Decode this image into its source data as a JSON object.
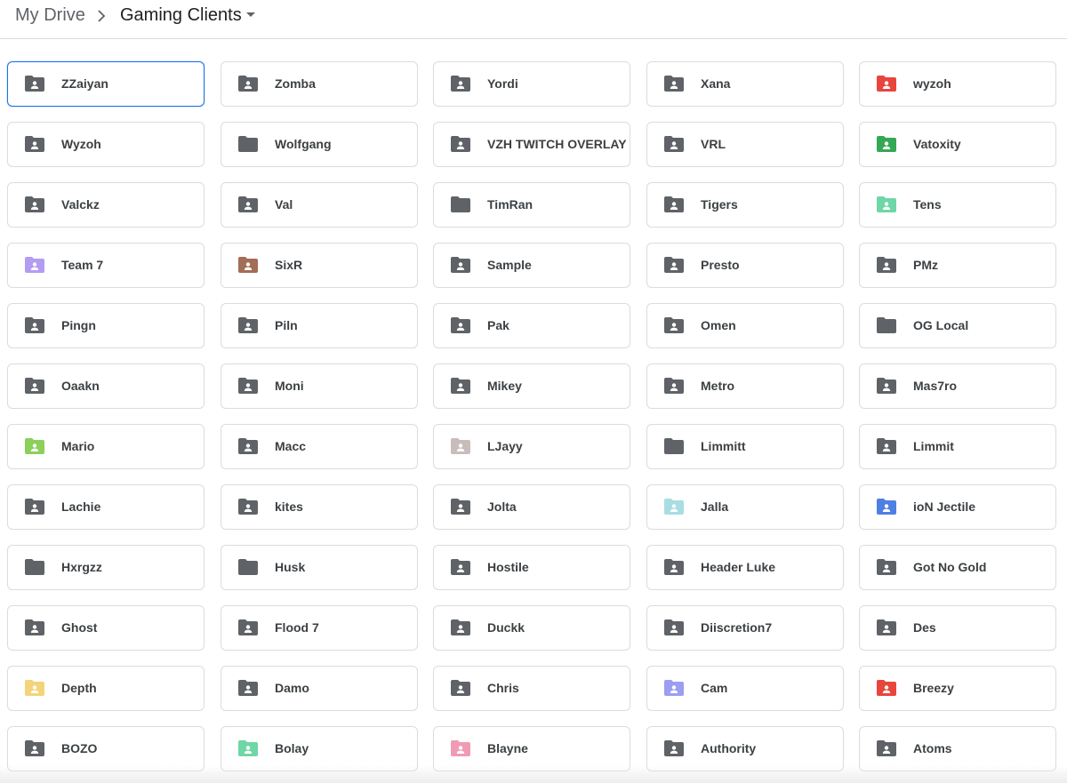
{
  "breadcrumb": {
    "root": "My Drive",
    "current": "Gaming Clients"
  },
  "colors": {
    "default_folder": "#5f6368",
    "selected_border": "#1a73e8"
  },
  "folders": [
    {
      "name": "ZZaiyan",
      "color": "#5f6368",
      "shared": true,
      "selected": true
    },
    {
      "name": "Zomba",
      "color": "#5f6368",
      "shared": true
    },
    {
      "name": "Yordi",
      "color": "#5f6368",
      "shared": true
    },
    {
      "name": "Xana",
      "color": "#5f6368",
      "shared": true
    },
    {
      "name": "wyzoh",
      "color": "#e8453c",
      "shared": true
    },
    {
      "name": "Wyzoh",
      "color": "#5f6368",
      "shared": true
    },
    {
      "name": "Wolfgang",
      "color": "#5f6368",
      "shared": false
    },
    {
      "name": "VZH TWITCH OVERLAY",
      "color": "#5f6368",
      "shared": true
    },
    {
      "name": "VRL",
      "color": "#5f6368",
      "shared": true
    },
    {
      "name": "Vatoxity",
      "color": "#34a853",
      "shared": true
    },
    {
      "name": "Valckz",
      "color": "#5f6368",
      "shared": true
    },
    {
      "name": "Val",
      "color": "#5f6368",
      "shared": true
    },
    {
      "name": "TimRan",
      "color": "#5f6368",
      "shared": false
    },
    {
      "name": "Tigers",
      "color": "#5f6368",
      "shared": true
    },
    {
      "name": "Tens",
      "color": "#6fd6a6",
      "shared": true
    },
    {
      "name": "Team 7",
      "color": "#b49cf2",
      "shared": true
    },
    {
      "name": "SixR",
      "color": "#a26e57",
      "shared": true
    },
    {
      "name": "Sample",
      "color": "#5f6368",
      "shared": true
    },
    {
      "name": "Presto",
      "color": "#5f6368",
      "shared": true
    },
    {
      "name": "PMz",
      "color": "#5f6368",
      "shared": true
    },
    {
      "name": "Pingn",
      "color": "#5f6368",
      "shared": true
    },
    {
      "name": "Piln",
      "color": "#5f6368",
      "shared": true
    },
    {
      "name": "Pak",
      "color": "#5f6368",
      "shared": true
    },
    {
      "name": "Omen",
      "color": "#5f6368",
      "shared": true
    },
    {
      "name": "OG Local",
      "color": "#5f6368",
      "shared": false
    },
    {
      "name": "Oaakn",
      "color": "#5f6368",
      "shared": true
    },
    {
      "name": "Moni",
      "color": "#5f6368",
      "shared": true
    },
    {
      "name": "Mikey",
      "color": "#5f6368",
      "shared": true
    },
    {
      "name": "Metro",
      "color": "#5f6368",
      "shared": true
    },
    {
      "name": "Mas7ro",
      "color": "#5f6368",
      "shared": true
    },
    {
      "name": "Mario",
      "color": "#8bd05a",
      "shared": true
    },
    {
      "name": "Macc",
      "color": "#5f6368",
      "shared": true
    },
    {
      "name": "LJayy",
      "color": "#cbbcbc",
      "shared": true
    },
    {
      "name": "Limmitt",
      "color": "#5f6368",
      "shared": false
    },
    {
      "name": "Limmit",
      "color": "#5f6368",
      "shared": true
    },
    {
      "name": "Lachie",
      "color": "#5f6368",
      "shared": true
    },
    {
      "name": "kites",
      "color": "#5f6368",
      "shared": true
    },
    {
      "name": "Jolta",
      "color": "#5f6368",
      "shared": true
    },
    {
      "name": "Jalla",
      "color": "#a8dde4",
      "shared": true
    },
    {
      "name": "ioN Jectile",
      "color": "#4e7fe3",
      "shared": true
    },
    {
      "name": "Hxrgzz",
      "color": "#5f6368",
      "shared": false
    },
    {
      "name": "Husk",
      "color": "#5f6368",
      "shared": false
    },
    {
      "name": "Hostile",
      "color": "#5f6368",
      "shared": true
    },
    {
      "name": "Header Luke",
      "color": "#5f6368",
      "shared": true
    },
    {
      "name": "Got No Gold",
      "color": "#5f6368",
      "shared": true
    },
    {
      "name": "Ghost",
      "color": "#5f6368",
      "shared": true
    },
    {
      "name": "Flood 7",
      "color": "#5f6368",
      "shared": true
    },
    {
      "name": "Duckk",
      "color": "#5f6368",
      "shared": true
    },
    {
      "name": "Diiscretion7",
      "color": "#5f6368",
      "shared": true
    },
    {
      "name": "Des",
      "color": "#5f6368",
      "shared": true
    },
    {
      "name": "Depth",
      "color": "#f3d47a",
      "shared": true
    },
    {
      "name": "Damo",
      "color": "#5f6368",
      "shared": true
    },
    {
      "name": "Chris",
      "color": "#5f6368",
      "shared": true
    },
    {
      "name": "Cam",
      "color": "#9c9ef2",
      "shared": true
    },
    {
      "name": "Breezy",
      "color": "#e8453c",
      "shared": true
    },
    {
      "name": "BOZO",
      "color": "#5f6368",
      "shared": true
    },
    {
      "name": "Bolay",
      "color": "#6fd6a6",
      "shared": true
    },
    {
      "name": "Blayne",
      "color": "#f09bb4",
      "shared": true
    },
    {
      "name": "Authority",
      "color": "#5f6368",
      "shared": true
    },
    {
      "name": "Atoms",
      "color": "#5f6368",
      "shared": true
    }
  ]
}
